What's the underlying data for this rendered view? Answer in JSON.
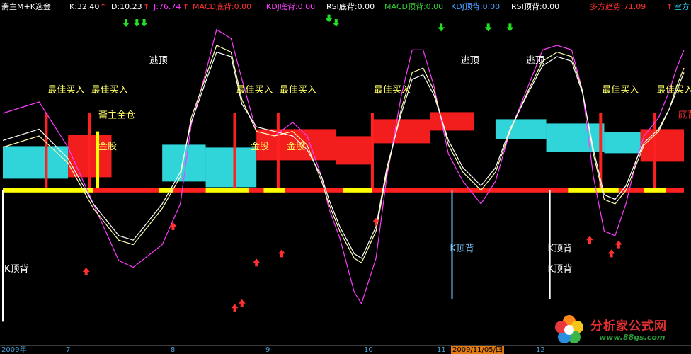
{
  "header": {
    "indicator_name": "斋主M+K选金",
    "items": [
      {
        "key": "k",
        "text": "K:32.40",
        "color": "#ffffff"
      },
      {
        "key": "k_arrow",
        "text": "↑",
        "color": "#ff3030"
      },
      {
        "key": "d",
        "text": "D:10.23",
        "color": "#ffffff"
      },
      {
        "key": "d_arrow",
        "text": "↑",
        "color": "#ff3030"
      },
      {
        "key": "j",
        "text": "J:76.74",
        "color": "#ff3cff"
      },
      {
        "key": "j_arrow",
        "text": "↑",
        "color": "#ff3030"
      },
      {
        "key": "macd_bottom",
        "text": "MACD底背:0.00",
        "color": "#ff3030"
      },
      {
        "key": "kdj_bottom",
        "text": "KDJ底背:0.00",
        "color": "#ff3cff"
      },
      {
        "key": "rsi_bottom",
        "text": "RSI底背:0.00",
        "color": "#ffffff"
      },
      {
        "key": "macd_top",
        "text": "MACD顶背:0.00",
        "color": "#33cc33"
      },
      {
        "key": "kdj_top",
        "text": "KDJ顶背:0.00",
        "color": "#4aa0ff"
      },
      {
        "key": "rsi_top",
        "text": "RSI顶背:0.00",
        "color": "#ffffff"
      },
      {
        "key": "trend_long",
        "text": "多方趋势:71.09",
        "color": "#ff3030"
      },
      {
        "key": "trend_long_arrow",
        "text": "↑",
        "color": "#ff3030"
      },
      {
        "key": "trend_short",
        "text": "空方",
        "color": "#33ddff"
      }
    ]
  },
  "bottom_axis": {
    "labels": [
      "2009年",
      "7",
      "8",
      "9",
      "10",
      "11",
      "12"
    ],
    "highlight_date": "2009/11/05/四"
  },
  "watermark": {
    "title": "分析家公式网",
    "url": "www.88gs.com"
  },
  "chart_data": {
    "type": "line",
    "x_count": 188,
    "y_range": [
      -30,
      110
    ],
    "series": [
      {
        "color": "#ff3cff",
        "points": [
          [
            0,
            70
          ],
          [
            10,
            75
          ],
          [
            18,
            55
          ],
          [
            25,
            30
          ],
          [
            32,
            5
          ],
          [
            36,
            2
          ],
          [
            44,
            12
          ],
          [
            49,
            30
          ],
          [
            52,
            65
          ],
          [
            56,
            88
          ],
          [
            59,
            107
          ],
          [
            63,
            103
          ],
          [
            66,
            85
          ],
          [
            70,
            62
          ],
          [
            75,
            60
          ],
          [
            80,
            66
          ],
          [
            84,
            60
          ],
          [
            88,
            42
          ],
          [
            90,
            28
          ],
          [
            93,
            15
          ],
          [
            97,
            -9
          ],
          [
            99,
            -14
          ],
          [
            103,
            6
          ],
          [
            106,
            42
          ],
          [
            110,
            78
          ],
          [
            113,
            98
          ],
          [
            116,
            98
          ],
          [
            119,
            82
          ],
          [
            123,
            52
          ],
          [
            127,
            40
          ],
          [
            132,
            30
          ],
          [
            136,
            40
          ],
          [
            140,
            62
          ],
          [
            145,
            82
          ],
          [
            149,
            98
          ],
          [
            153,
            100
          ],
          [
            157,
            98
          ],
          [
            160,
            80
          ],
          [
            163,
            42
          ],
          [
            166,
            18
          ],
          [
            169,
            16
          ],
          [
            172,
            30
          ],
          [
            175,
            50
          ],
          [
            177,
            60
          ],
          [
            181,
            68
          ],
          [
            184,
            80
          ],
          [
            186,
            90
          ],
          [
            188,
            98
          ]
        ]
      },
      {
        "color": "#ffffaa",
        "points": [
          [
            0,
            55
          ],
          [
            10,
            60
          ],
          [
            18,
            48
          ],
          [
            25,
            28
          ],
          [
            32,
            14
          ],
          [
            36,
            12
          ],
          [
            44,
            28
          ],
          [
            49,
            42
          ],
          [
            52,
            68
          ],
          [
            56,
            86
          ],
          [
            59,
            100
          ],
          [
            63,
            97
          ],
          [
            66,
            76
          ],
          [
            70,
            62
          ],
          [
            75,
            60
          ],
          [
            80,
            62
          ],
          [
            84,
            56
          ],
          [
            88,
            40
          ],
          [
            90,
            30
          ],
          [
            93,
            18
          ],
          [
            97,
            6
          ],
          [
            99,
            4
          ],
          [
            103,
            18
          ],
          [
            106,
            44
          ],
          [
            110,
            72
          ],
          [
            113,
            88
          ],
          [
            116,
            90
          ],
          [
            119,
            80
          ],
          [
            123,
            56
          ],
          [
            127,
            44
          ],
          [
            132,
            36
          ],
          [
            136,
            44
          ],
          [
            140,
            62
          ],
          [
            145,
            80
          ],
          [
            149,
            93
          ],
          [
            153,
            97
          ],
          [
            157,
            95
          ],
          [
            160,
            80
          ],
          [
            163,
            52
          ],
          [
            166,
            32
          ],
          [
            169,
            30
          ],
          [
            172,
            36
          ],
          [
            175,
            48
          ],
          [
            177,
            56
          ],
          [
            181,
            62
          ],
          [
            184,
            72
          ],
          [
            186,
            82
          ],
          [
            188,
            90
          ]
        ]
      },
      {
        "color": "#ffffff",
        "points": [
          [
            0,
            58
          ],
          [
            10,
            63
          ],
          [
            18,
            50
          ],
          [
            25,
            30
          ],
          [
            32,
            16
          ],
          [
            36,
            14
          ],
          [
            44,
            30
          ],
          [
            49,
            44
          ],
          [
            52,
            66
          ],
          [
            56,
            84
          ],
          [
            59,
            97
          ],
          [
            63,
            95
          ],
          [
            66,
            74
          ],
          [
            70,
            64
          ],
          [
            75,
            62
          ],
          [
            80,
            60
          ],
          [
            84,
            54
          ],
          [
            88,
            42
          ],
          [
            90,
            32
          ],
          [
            93,
            20
          ],
          [
            97,
            8
          ],
          [
            99,
            6
          ],
          [
            103,
            20
          ],
          [
            106,
            46
          ],
          [
            110,
            70
          ],
          [
            113,
            85
          ],
          [
            116,
            87
          ],
          [
            119,
            78
          ],
          [
            123,
            58
          ],
          [
            127,
            46
          ],
          [
            132,
            38
          ],
          [
            136,
            46
          ],
          [
            140,
            63
          ],
          [
            145,
            79
          ],
          [
            149,
            91
          ],
          [
            153,
            95
          ],
          [
            157,
            93
          ],
          [
            160,
            79
          ],
          [
            163,
            54
          ],
          [
            166,
            34
          ],
          [
            169,
            32
          ],
          [
            172,
            38
          ],
          [
            175,
            50
          ],
          [
            177,
            57
          ],
          [
            181,
            63
          ],
          [
            184,
            72
          ],
          [
            186,
            80
          ],
          [
            188,
            88
          ]
        ]
      }
    ],
    "labels": [
      {
        "x": 12,
        "text": "最佳买入",
        "color": "#ffff66"
      },
      {
        "x": 24,
        "text": "最佳买入",
        "color": "#ffff66"
      },
      {
        "x": 64,
        "text": "最佳买入",
        "color": "#ffff66"
      },
      {
        "x": 76,
        "text": "最佳买入",
        "color": "#ffff66"
      },
      {
        "x": 102,
        "text": "最佳买入",
        "color": "#ffff66"
      },
      {
        "x": 165,
        "text": "最佳买入",
        "color": "#ffff66"
      },
      {
        "x": 180,
        "text": "最佳买入",
        "color": "#ffff66"
      },
      {
        "x": 26,
        "text": "金股",
        "color": "#ffff66"
      },
      {
        "x": 68,
        "text": "金股",
        "color": "#ffff66"
      },
      {
        "x": 78,
        "text": "金股",
        "color": "#ffff66"
      },
      {
        "x": 26,
        "text": "斋主全仓",
        "color": "#ffff66"
      },
      {
        "x": 40,
        "text": "逃顶",
        "color": "#ffffff"
      },
      {
        "x": 126,
        "text": "逃顶",
        "color": "#ffffff"
      },
      {
        "x": 144,
        "text": "逃顶",
        "color": "#ffffff"
      },
      {
        "x": 0,
        "text": "K顶背",
        "color": "#ffffff"
      },
      {
        "x": 123,
        "text": "K顶背",
        "color": "#7ac8ff"
      },
      {
        "x": 150,
        "text": "K顶背",
        "color": "#ffffff"
      },
      {
        "x": 150,
        "text": "K顶背",
        "color": "#ffffff"
      },
      {
        "x": 186,
        "text": "底背",
        "color": "#ff3030"
      }
    ]
  }
}
